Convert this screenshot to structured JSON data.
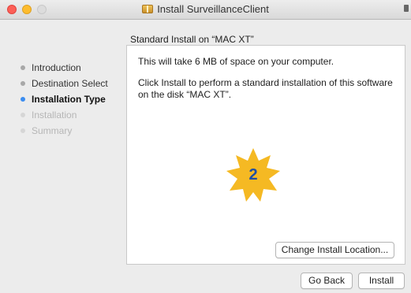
{
  "window": {
    "title": "Install SurveillanceClient"
  },
  "panel": {
    "heading": "Standard Install on “MAC XT”"
  },
  "sidebar": {
    "items": [
      {
        "label": "Introduction",
        "state": "done"
      },
      {
        "label": "Destination Select",
        "state": "done"
      },
      {
        "label": "Installation Type",
        "state": "active"
      },
      {
        "label": "Installation",
        "state": "disabled"
      },
      {
        "label": "Summary",
        "state": "disabled"
      }
    ]
  },
  "content": {
    "space_text": "This will take 6 MB of space on your computer.",
    "install_text": "Click Install to perform a standard installation of this software on the disk “MAC XT”.",
    "badge_number": "2"
  },
  "buttons": {
    "change_location": "Change Install Location...",
    "go_back": "Go Back",
    "install": "Install"
  },
  "colors": {
    "accent": "#3b8df0",
    "badge": "#f5b923",
    "badge_text": "#1f4fa3"
  },
  "icons": [
    "package-icon",
    "lock-icon"
  ]
}
